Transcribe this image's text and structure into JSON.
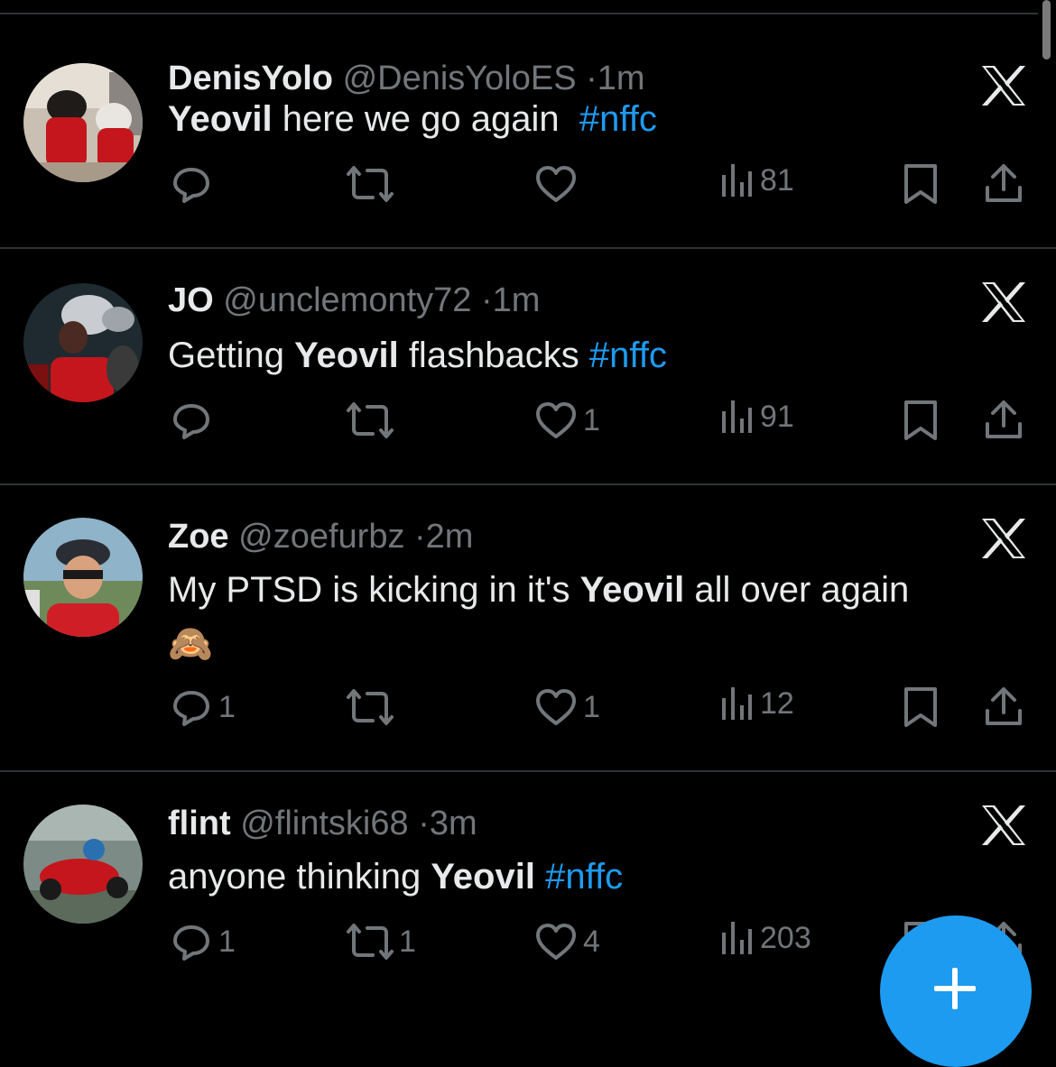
{
  "tweets": [
    {
      "name": "DenisYolo",
      "handle": "@DenisYoloES",
      "separator": "·",
      "time": "1m",
      "text_parts": [
        {
          "text": "Yeovil",
          "style": "bold"
        },
        {
          "text": " here we go again  ",
          "style": "normal"
        },
        {
          "text": "#nffc",
          "style": "hashtag"
        }
      ],
      "replies": "",
      "retweets": "",
      "likes": "",
      "views": "81"
    },
    {
      "name": "JO",
      "handle": "@unclemonty72",
      "separator": "·",
      "time": "1m",
      "text_parts": [
        {
          "text": "Getting ",
          "style": "normal"
        },
        {
          "text": "Yeovil",
          "style": "bold"
        },
        {
          "text": " flashbacks ",
          "style": "normal"
        },
        {
          "text": "#nffc",
          "style": "hashtag"
        }
      ],
      "replies": "",
      "retweets": "",
      "likes": "1",
      "views": "91"
    },
    {
      "name": "Zoe",
      "handle": "@zoefurbz",
      "separator": "·",
      "time": "2m",
      "text_parts": [
        {
          "text": "My PTSD is kicking in it's ",
          "style": "normal"
        },
        {
          "text": "Yeovil",
          "style": "bold"
        },
        {
          "text": " all over again",
          "style": "normal"
        }
      ],
      "emoji": "🙈",
      "replies": "1",
      "retweets": "",
      "likes": "1",
      "views": "12"
    },
    {
      "name": "flint",
      "handle": "@flintski68",
      "separator": "·",
      "time": "3m",
      "text_parts": [
        {
          "text": "anyone thinking ",
          "style": "normal"
        },
        {
          "text": "Yeovil",
          "style": "bold"
        },
        {
          "text": " ",
          "style": "normal"
        },
        {
          "text": "#nffc",
          "style": "hashtag"
        }
      ],
      "replies": "1",
      "retweets": "1",
      "likes": "4",
      "views": "203"
    }
  ],
  "icons": {
    "reply": "reply-icon",
    "retweet": "retweet-icon",
    "like": "like-icon",
    "views": "views-icon",
    "bookmark": "bookmark-icon",
    "share": "share-icon",
    "platform": "x-logo-icon",
    "compose": "plus-icon"
  },
  "colors": {
    "background": "#000000",
    "primary_text": "#e7e9ea",
    "secondary_text": "#71767b",
    "hashtag": "#1d9bf0",
    "fab": "#1d9bf0",
    "divider": "#2f3336"
  }
}
